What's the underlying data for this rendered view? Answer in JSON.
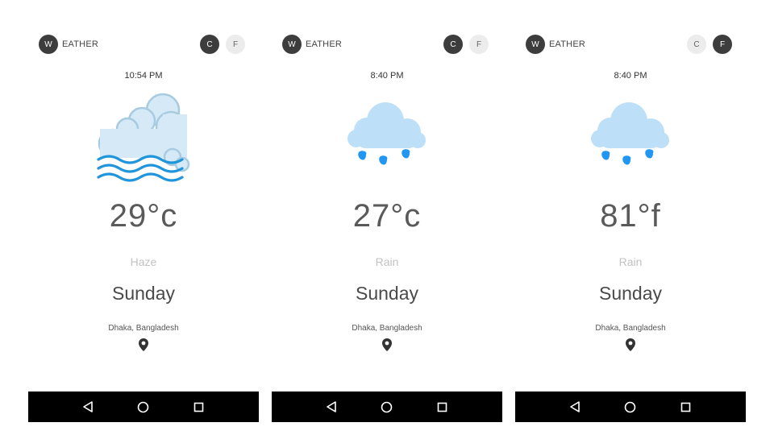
{
  "colors": {
    "accent_dark": "#3d3d3d",
    "cloud_fill": "#bde0f8",
    "cloud_stroke": "#a7cbe0",
    "haze_wave": "#1f95db",
    "rain_drop": "#2196f3",
    "navbar": "#000000"
  },
  "screens": [
    {
      "logo": {
        "letter": "W",
        "text": "EATHER"
      },
      "units": {
        "c_label": "C",
        "f_label": "F",
        "active": "C"
      },
      "time": "10:54 PM",
      "icon": "haze-cloud-icon",
      "temperature": "29°c",
      "condition": "Haze",
      "day": "Sunday",
      "location": "Dhaka, Bangladesh"
    },
    {
      "logo": {
        "letter": "W",
        "text": "EATHER"
      },
      "units": {
        "c_label": "C",
        "f_label": "F",
        "active": "C"
      },
      "time": "8:40 PM",
      "icon": "rain-cloud-icon",
      "temperature": "27°c",
      "condition": "Rain",
      "day": "Sunday",
      "location": "Dhaka, Bangladesh"
    },
    {
      "logo": {
        "letter": "W",
        "text": "EATHER"
      },
      "units": {
        "c_label": "C",
        "f_label": "F",
        "active": "F"
      },
      "time": "8:40 PM",
      "icon": "rain-cloud-icon",
      "temperature": "81°f",
      "condition": "Rain",
      "day": "Sunday",
      "location": "Dhaka, Bangladesh"
    }
  ],
  "navbar_icons": [
    "back-icon",
    "home-icon",
    "recents-icon"
  ]
}
